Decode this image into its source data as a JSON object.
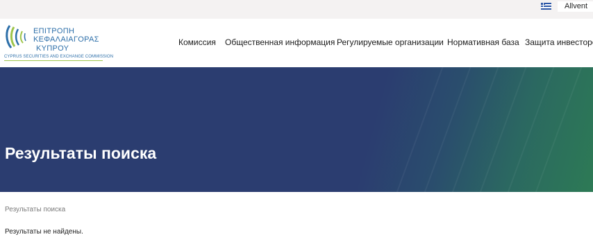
{
  "topbar": {
    "flag_icon": "greek-flag-icon",
    "language_label": "Allvent"
  },
  "logo": {
    "line1": "ΕΠΙΤΡΟΠΗ",
    "line2": "ΚΕΦΑΛΑΙΑΓΟΡΑΣ",
    "line3": "ΚΥΠΡΟΥ",
    "subtitle": "CYPRUS SECURITIES AND EXCHANGE COMMISSION",
    "colors": {
      "blue": "#2d6fa9",
      "green": "#9ec54a"
    }
  },
  "nav": {
    "items": [
      {
        "label": "Комиссия"
      },
      {
        "label": "Общественная информация"
      },
      {
        "label": "Регулируемые организации"
      },
      {
        "label": "Нормативная база"
      },
      {
        "label": "Защита инвесторов"
      }
    ]
  },
  "banner": {
    "title": "Результаты поиска",
    "colors": {
      "primary": "#2b3d70",
      "accent": "#2d7a55"
    }
  },
  "content": {
    "breadcrumb": "Результаты поиска",
    "message": "Результаты не найдены."
  }
}
